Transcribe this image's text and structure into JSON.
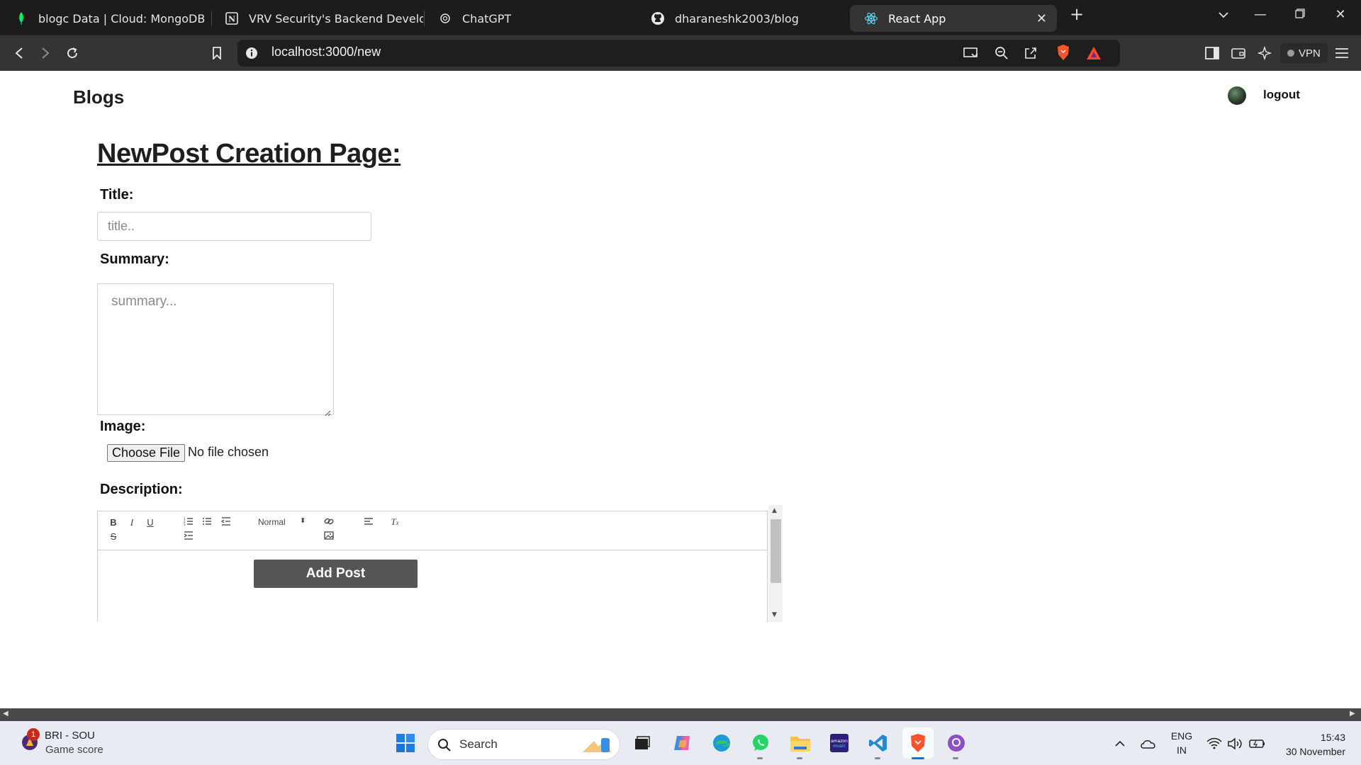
{
  "browser": {
    "tabs": [
      {
        "label": "blogc Data | Cloud: MongoDB Cloud",
        "favicon": "mongodb-leaf-icon",
        "active": false
      },
      {
        "label": "VRV Security's Backend Developer In",
        "favicon": "notion-icon",
        "active": false
      },
      {
        "label": "ChatGPT",
        "favicon": "chatgpt-icon",
        "active": false
      },
      {
        "label": "dharaneshk2003/blog",
        "favicon": "github-icon",
        "active": false
      },
      {
        "label": "React App",
        "favicon": "react-icon",
        "active": true
      }
    ],
    "url": "localhost:3000/new",
    "vpn_label": "VPN"
  },
  "header": {
    "brand": "Blogs",
    "logout": "logout"
  },
  "form": {
    "heading": "NewPost Creation Page:",
    "title_label": "Title:",
    "title_placeholder": "title..",
    "summary_label": "Summary:",
    "summary_placeholder": "summary...",
    "image_label": "Image:",
    "file_button": "Choose File",
    "file_status": "No file chosen",
    "description_label": "Description:",
    "editor": {
      "header_select": "Normal"
    },
    "submit": "Add Post"
  },
  "taskbar": {
    "widget_title": "BRI - SOU",
    "widget_subtitle": "Game score",
    "widget_badge": "1",
    "search_label": "Search",
    "language_top": "ENG",
    "language_bottom": "IN",
    "time": "15:43",
    "date": "30 November"
  },
  "colors": {
    "tabstrip": "#1c1c1c",
    "toolbar": "#343434",
    "button": "#555555",
    "taskbar": "#e8ecf2"
  }
}
